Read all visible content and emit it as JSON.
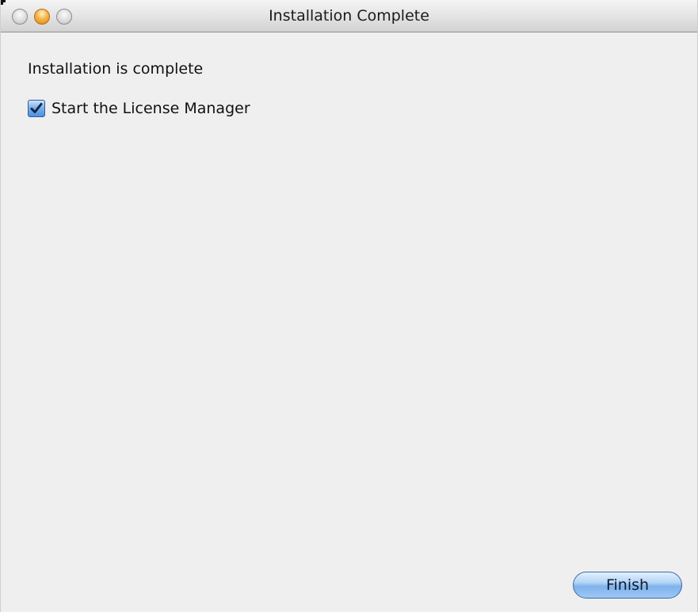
{
  "window": {
    "title": "Installation Complete"
  },
  "content": {
    "message": "Installation is complete",
    "checkbox": {
      "label": "Start the License Manager",
      "checked": true
    }
  },
  "actions": {
    "finish_label": "Finish"
  },
  "icons": {
    "close": "close-icon",
    "minimize": "minimize-icon",
    "zoom": "zoom-icon",
    "checkmark": "checkmark-icon"
  },
  "colors": {
    "window_bg": "#efefef",
    "accent": "#4c8fdc",
    "minimize": "#f6b44a"
  }
}
